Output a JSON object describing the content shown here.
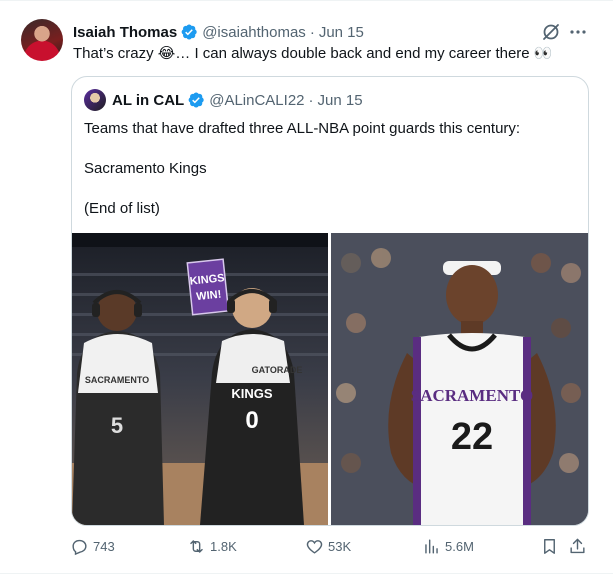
{
  "author": {
    "name": "Isaiah Thomas",
    "handle": "@isaiahthomas",
    "separator": "·",
    "date": "Jun 15"
  },
  "tweet": {
    "text": "That’s crazy 😂… I can always double back and end my career there 👀"
  },
  "quote": {
    "name": "AL in CAL",
    "handle": "@ALinCALI22",
    "separator": "·",
    "date": "Jun 15",
    "line1": "Teams that have drafted three ALL-NBA point guards this century:",
    "line2": "Sacramento Kings",
    "line3": "(End of list)",
    "images": {
      "left": {
        "sign_line1": "KINGS",
        "sign_line2": "WIN!",
        "jersey_left": "5",
        "jersey_right": "0",
        "jersey_right_word": "KINGS",
        "towel_left": "SACRAMENTO",
        "towel_right": "GATORADE"
      },
      "right": {
        "jersey_word": "SACRAMENTO",
        "jersey_number": "22"
      }
    }
  },
  "actions": {
    "replies": "743",
    "retweets": "1.8K",
    "likes": "53K",
    "views": "5.6M"
  },
  "colors": {
    "verified": "#1d9bf0",
    "muted": "#536471",
    "kings_purple": "#5a2d81"
  }
}
